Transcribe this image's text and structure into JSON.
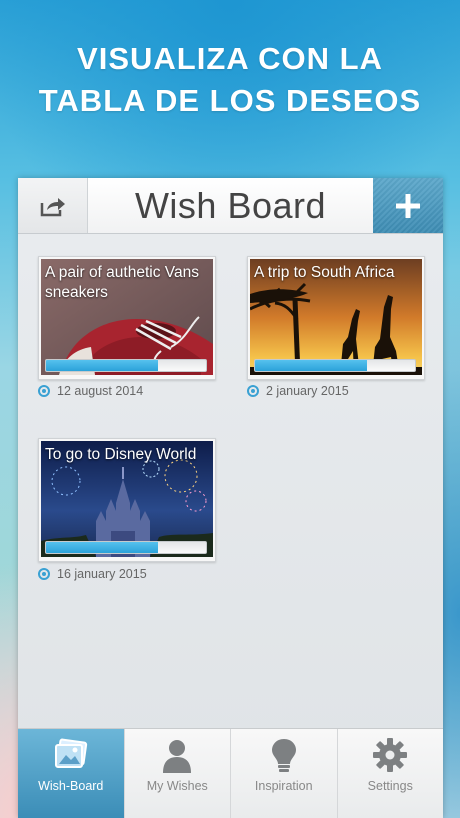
{
  "promo": {
    "line1": "VISUALIZA CON LA",
    "line2": "TABLA DE LOS DESEOS"
  },
  "navbar": {
    "title": "Wish Board",
    "share_icon": "share-icon",
    "add_icon": "plus-icon"
  },
  "wishes": [
    {
      "title": "A pair of authetic Vans sneakers",
      "date": "12 august 2014",
      "progress": 0.7
    },
    {
      "title": "A trip to South Africa",
      "date": "2 january 2015",
      "progress": 0.7
    },
    {
      "title": "To go to Disney World",
      "date": "16 january 2015",
      "progress": 0.7
    }
  ],
  "tabs": [
    {
      "label": "Wish-Board",
      "icon": "photos-icon",
      "active": true
    },
    {
      "label": "My Wishes",
      "icon": "person-icon",
      "active": false
    },
    {
      "label": "Inspiration",
      "icon": "lightbulb-icon",
      "active": false
    },
    {
      "label": "Settings",
      "icon": "gear-icon",
      "active": false
    }
  ],
  "colors": {
    "accent": "#3aa1d3",
    "active_tab": "#4c9cc4"
  }
}
